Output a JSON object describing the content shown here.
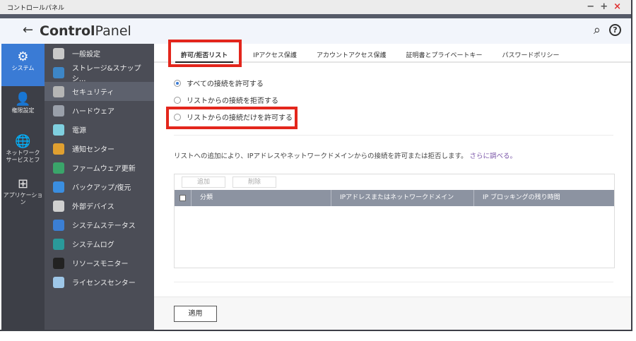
{
  "window": {
    "title": "コントロールパネル",
    "minimize": "−",
    "maximize": "+",
    "close": "×"
  },
  "header": {
    "back": "←",
    "title_bold": "Control",
    "title_rest": "Panel",
    "search_icon": "⌕",
    "help_icon": "?"
  },
  "nav_primary": [
    {
      "label": "システム",
      "icon": "⚙",
      "active": true
    },
    {
      "label": "権限設定",
      "icon": "👤"
    },
    {
      "label": "ネットワーク\nサービスとフ",
      "icon": "🌐"
    },
    {
      "label": "アプリケーション",
      "icon": "⊞"
    }
  ],
  "nav_secondary": [
    {
      "label": "一般設定",
      "color": "#c9c9c9"
    },
    {
      "label": "ストレージ&スナップシ...",
      "color": "#3d86c6"
    },
    {
      "label": "セキュリティ",
      "color": "#b5b5b5",
      "active": true
    },
    {
      "label": "ハードウェア",
      "color": "#9aa0aa"
    },
    {
      "label": "電源",
      "color": "#7fd0e0"
    },
    {
      "label": "通知センター",
      "color": "#e0a030"
    },
    {
      "label": "ファームウェア更新",
      "color": "#3aa56a"
    },
    {
      "label": "バックアップ/復元",
      "color": "#3a8ee0"
    },
    {
      "label": "外部デバイス",
      "color": "#d0d0d0"
    },
    {
      "label": "システムステータス",
      "color": "#3b7fd4"
    },
    {
      "label": "システムログ",
      "color": "#2a9a9a"
    },
    {
      "label": "リソースモニター",
      "color": "#222"
    },
    {
      "label": "ライセンスセンター",
      "color": "#9ec7e8"
    }
  ],
  "tabs": [
    {
      "label": "許可/拒否リスト",
      "active": true
    },
    {
      "label": "IPアクセス保護"
    },
    {
      "label": "アカウントアクセス保護"
    },
    {
      "label": "証明書とプライベートキー"
    },
    {
      "label": "パスワードポリシー"
    }
  ],
  "radios": [
    {
      "label": "すべての接続を許可する",
      "checked": true
    },
    {
      "label": "リストからの接続を拒否する",
      "checked": false
    },
    {
      "label": "リストからの接続だけを許可する",
      "checked": false
    }
  ],
  "description": "リストへの追加により、IPアドレスやネットワークドメインからの接続を許可または拒否します。",
  "learn_more": "さらに調べる。",
  "table": {
    "add": "追加",
    "delete": "削除",
    "columns": [
      "分類",
      "IPアドレスまたはネットワークドメイン",
      "IP ブロッキングの残り時間"
    ]
  },
  "apply": "適用",
  "colors": {
    "accent": "#3a7bd5",
    "highlight": "#e3261c"
  }
}
